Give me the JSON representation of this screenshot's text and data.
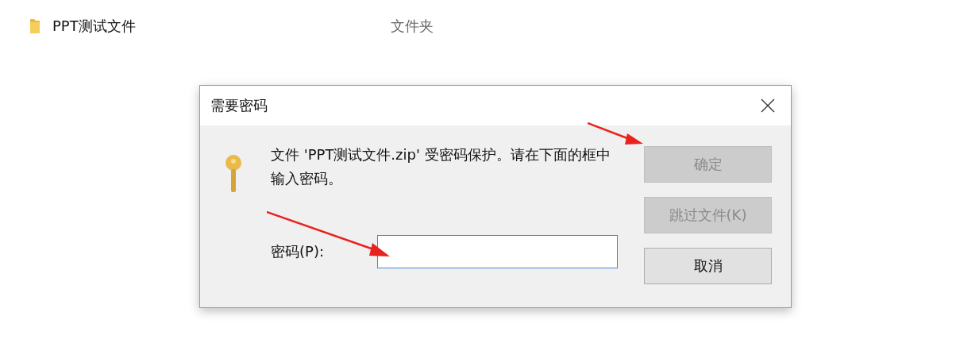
{
  "file_row": {
    "name": "PPT测试文件",
    "type": "文件夹"
  },
  "dialog": {
    "title": "需要密码",
    "message": "文件 'PPT测试文件.zip' 受密码保护。请在下面的框中输入密码。",
    "password_label": "密码(P):",
    "buttons": [
      {
        "label": "确定",
        "disabled": true
      },
      {
        "label": "跳过文件(K)",
        "disabled": true
      },
      {
        "label": "取消",
        "disabled": false
      }
    ]
  }
}
